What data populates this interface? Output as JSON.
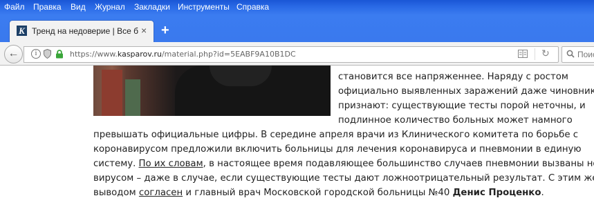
{
  "menubar": {
    "items": [
      "Файл",
      "Правка",
      "Вид",
      "Журнал",
      "Закладки",
      "Инструменты",
      "Справка"
    ]
  },
  "tab": {
    "favicon_letter": "K",
    "title": "Тренд на недоверие | Все б...",
    "close": "×"
  },
  "newtab": "+",
  "navbar": {
    "back": "←",
    "url_prefix": "https://www.",
    "url_host": "kasparov.ru",
    "url_path": "/material.php?id=5EABF9A10B1DC",
    "search_placeholder": "Поис"
  },
  "article": {
    "top_partial": "становится все напряженнее. Наряду с ростом",
    "right_lines": [
      "официально выявленных заражений даже чиновники",
      "признают: существующие тесты порой неточны, и",
      "подлинное количество больных может намного"
    ],
    "full_lines": [
      "превышать официальные цифры. В середине апреля врачи из Клинического комитета по борьбе с",
      "коронавирусом предложили включить больницы для лечения коронавируса и пневмонии в единую"
    ],
    "line_system_pre": "систему. ",
    "link_words": "По их словам",
    "line_system_post": ", в настоящее время подавляющее большинство случаев пневмонии вызваны новым",
    "line_virus": "вирусом – даже в случае, если существующие тесты дают ложноотрицательный результат. С этим же",
    "line_last_pre": "выводом ",
    "link_agreed": "согласен",
    "line_last_mid": " и главный врач Московской городской больницы №40 ",
    "bold_name": "Денис Проценко",
    "line_last_end": "."
  },
  "colors": {
    "chrome_blue": "#3b7cf0",
    "lock_green": "#3aa63a"
  }
}
